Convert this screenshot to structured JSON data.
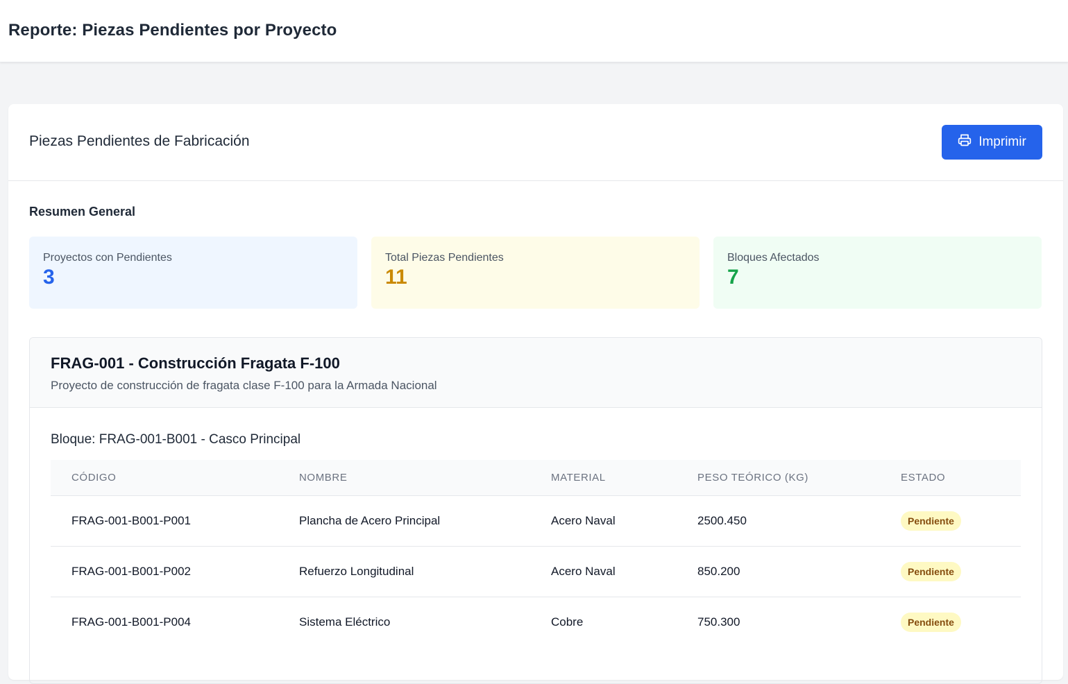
{
  "header": {
    "title": "Reporte: Piezas Pendientes por Proyecto"
  },
  "card": {
    "title": "Piezas Pendientes de Fabricación",
    "print_label": "Imprimir",
    "print_icon": "printer-icon"
  },
  "summary": {
    "title": "Resumen General",
    "stats": [
      {
        "label": "Proyectos con Pendientes",
        "value": "3",
        "color": "#2563eb",
        "background": "#eff6ff"
      },
      {
        "label": "Total Piezas Pendientes",
        "value": "11",
        "color": "#ca8a04",
        "background": "#fefce8"
      },
      {
        "label": "Bloques Afectados",
        "value": "7",
        "color": "#16a34a",
        "background": "#f0fdf4"
      }
    ]
  },
  "project": {
    "title": "FRAG-001 - Construcción Fragata F-100",
    "description": "Proyecto de construcción de fragata clase F-100 para la Armada Nacional",
    "block": {
      "title": "Bloque: FRAG-001-B001 - Casco Principal",
      "columns": [
        "Código",
        "Nombre",
        "Material",
        "Peso Teórico (kg)",
        "Estado"
      ],
      "rows": [
        {
          "codigo": "FRAG-001-B001-P001",
          "nombre": "Plancha de Acero Principal",
          "material": "Acero Naval",
          "peso": "2500.450",
          "estado": "Pendiente"
        },
        {
          "codigo": "FRAG-001-B001-P002",
          "nombre": "Refuerzo Longitudinal",
          "material": "Acero Naval",
          "peso": "850.200",
          "estado": "Pendiente"
        },
        {
          "codigo": "FRAG-001-B001-P004",
          "nombre": "Sistema Eléctrico",
          "material": "Cobre",
          "peso": "750.300",
          "estado": "Pendiente"
        }
      ]
    }
  },
  "colors": {
    "primary": "#2563eb",
    "badge_bg": "#fef9c3",
    "badge_text": "#854d0e"
  }
}
